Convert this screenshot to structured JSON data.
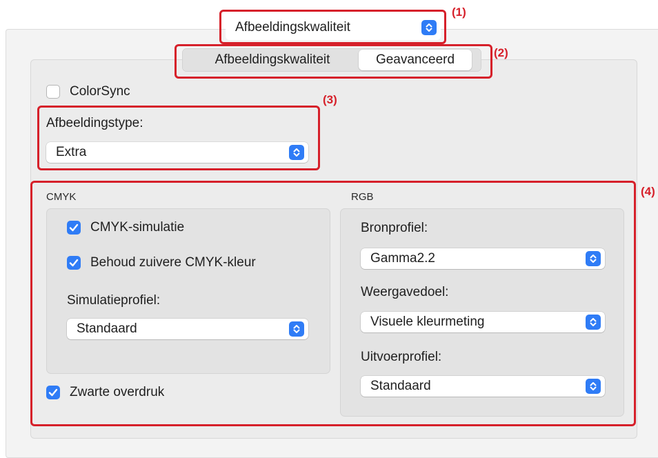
{
  "menu": {
    "selected": "Afbeeldingskwaliteit"
  },
  "tabs": [
    {
      "label": "Afbeeldingskwaliteit",
      "selected": false
    },
    {
      "label": "Geavanceerd",
      "selected": true
    }
  ],
  "colorsync": {
    "label": "ColorSync",
    "checked": false
  },
  "image_type": {
    "label": "Afbeeldingstype:",
    "value": "Extra"
  },
  "cmyk": {
    "header": "CMYK",
    "simulation": {
      "label": "CMYK-simulatie",
      "checked": true
    },
    "keep_pure": {
      "label": "Behoud zuivere CMYK-kleur",
      "checked": true
    },
    "profile_label": "Simulatieprofiel:",
    "profile_value": "Standaard"
  },
  "black_overprint": {
    "label": "Zwarte overdruk",
    "checked": true
  },
  "rgb": {
    "header": "RGB",
    "source_label": "Bronprofiel:",
    "source_value": "Gamma2.2",
    "intent_label": "Weergavedoel:",
    "intent_value": "Visuele kleurmeting",
    "output_label": "Uitvoerprofiel:",
    "output_value": "Standaard"
  },
  "callouts": [
    "(1)",
    "(2)",
    "(3)",
    "(4)"
  ],
  "colors": {
    "accent": "#2f7cf6",
    "annotation": "#d6202a"
  }
}
